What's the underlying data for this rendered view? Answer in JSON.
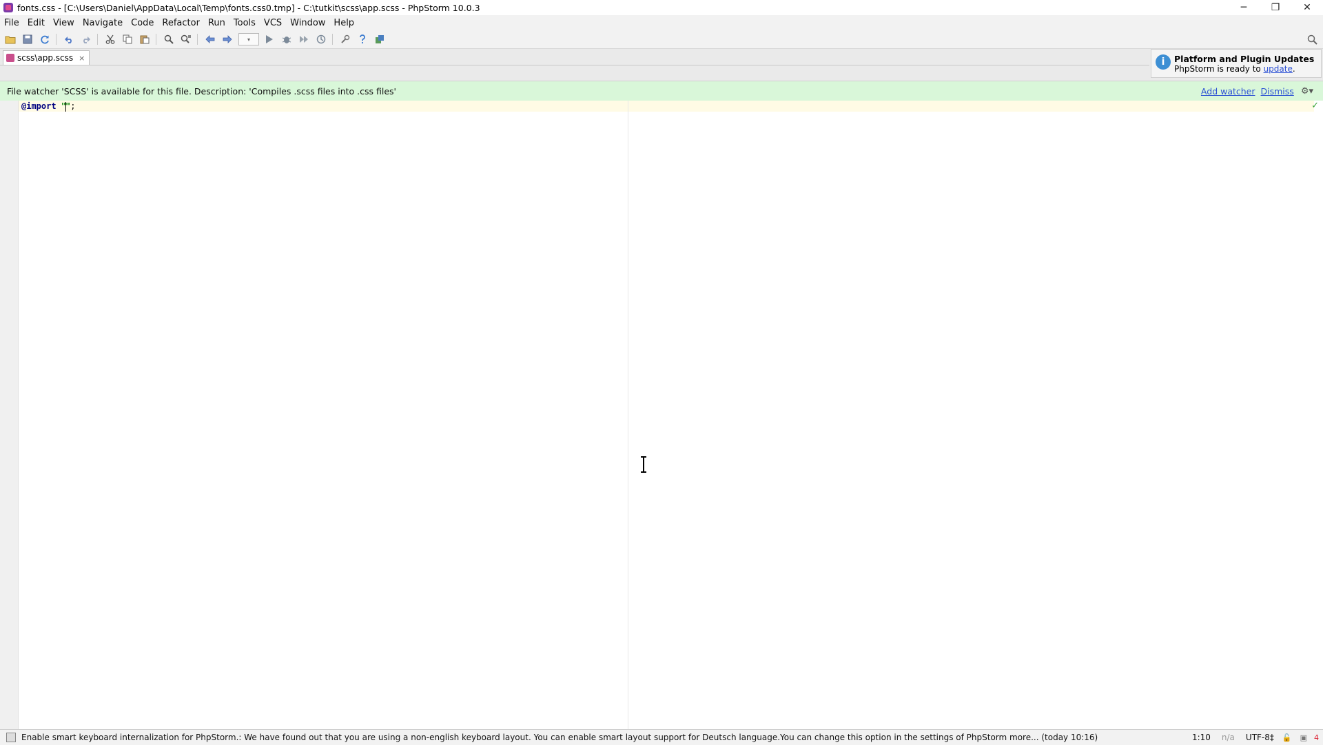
{
  "window": {
    "title": "fonts.css - [C:\\Users\\Daniel\\AppData\\Local\\Temp\\fonts.css0.tmp] - C:\\tutkit\\scss\\app.scss - PhpStorm 10.0.3",
    "minimize": "─",
    "restore": "❐",
    "close": "✕"
  },
  "menu": [
    "File",
    "Edit",
    "View",
    "Navigate",
    "Code",
    "Refactor",
    "Run",
    "Tools",
    "VCS",
    "Window",
    "Help"
  ],
  "tab": {
    "label": "scss\\app.scss",
    "close": "×"
  },
  "notification": {
    "title": "Platform and Plugin Updates",
    "body_prefix": "PhpStorm is ready to ",
    "link": "update",
    "body_suffix": "."
  },
  "banner": {
    "text": "File watcher 'SCSS' is available for this file. Description: 'Compiles .scss files into .css files'",
    "add_watcher": "Add watcher",
    "dismiss": "Dismiss",
    "gear": "⚙▾"
  },
  "editor": {
    "keyword": "@import",
    "space": " ",
    "quote_open": "\"",
    "quote_close": "\"",
    "semicolon": ";",
    "check": "✓"
  },
  "status": {
    "message": "Enable smart keyboard internalization for PhpStorm.: We have found out that you are using a non-english keyboard layout. You can enable smart layout support for Deutsch language.You can change this option in the settings of PhpStorm more... (today 10:16)",
    "position": "1:10",
    "na": "n/a",
    "encoding": "UTF-8‡",
    "lock": "🔓",
    "hector": "▣",
    "errors": "4"
  },
  "colors": {
    "banner_bg": "#d9f7d9",
    "link": "#2a4fd4",
    "keyword": "#000080",
    "string": "#008000",
    "current_line": "#fffbe5"
  }
}
